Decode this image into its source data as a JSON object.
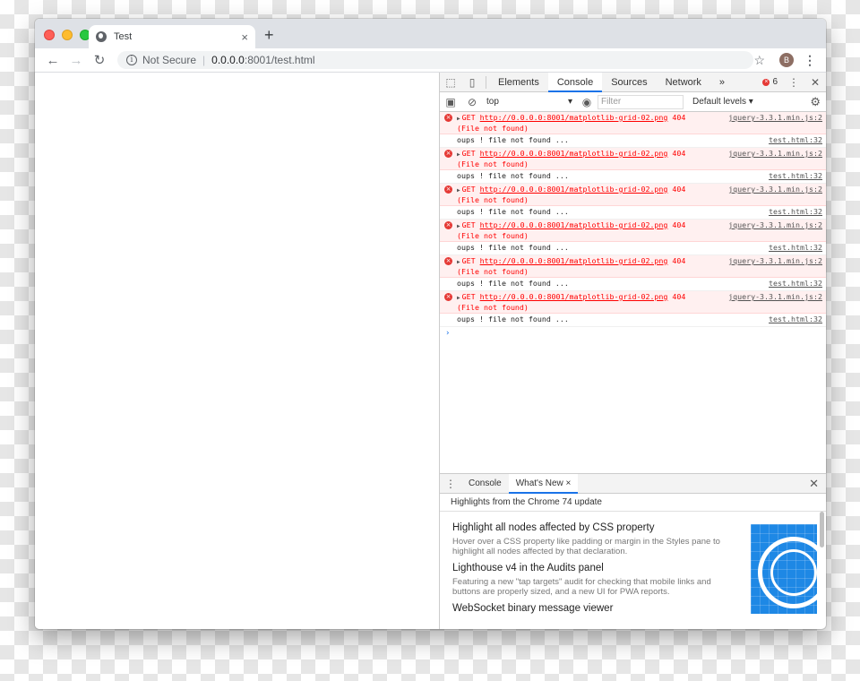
{
  "browser": {
    "tab_title": "Test",
    "tab_close": "×",
    "new_tab": "+",
    "url_security": "Not Secure",
    "url_host": "0.0.0.0",
    "url_rest": ":8001/test.html",
    "avatar_initial": "B"
  },
  "devtools": {
    "tabs": [
      "Elements",
      "Console",
      "Sources",
      "Network"
    ],
    "more_tabs": "»",
    "active_tab": "Console",
    "error_count": "6",
    "context": "top",
    "filter_placeholder": "Filter",
    "levels": "Default levels ▾",
    "messages": [
      {
        "type": "error",
        "method": "GET",
        "url": "http://0.0.0.0:8001/matplotlib-grid-02.png",
        "status": "404",
        "detail": "(File not found)",
        "source": "jquery-3.3.1.min.js:2"
      },
      {
        "type": "log",
        "text": "oups ! file not found ...",
        "source": "test.html:32"
      },
      {
        "type": "error",
        "method": "GET",
        "url": "http://0.0.0.0:8001/matplotlib-grid-02.png",
        "status": "404",
        "detail": "(File not found)",
        "source": "jquery-3.3.1.min.js:2"
      },
      {
        "type": "log",
        "text": "oups ! file not found ...",
        "source": "test.html:32"
      },
      {
        "type": "error",
        "method": "GET",
        "url": "http://0.0.0.0:8001/matplotlib-grid-02.png",
        "status": "404",
        "detail": "(File not found)",
        "source": "jquery-3.3.1.min.js:2"
      },
      {
        "type": "log",
        "text": "oups ! file not found ...",
        "source": "test.html:32"
      },
      {
        "type": "error",
        "method": "GET",
        "url": "http://0.0.0.0:8001/matplotlib-grid-02.png",
        "status": "404",
        "detail": "(File not found)",
        "source": "jquery-3.3.1.min.js:2"
      },
      {
        "type": "log",
        "text": "oups ! file not found ...",
        "source": "test.html:32"
      },
      {
        "type": "error",
        "method": "GET",
        "url": "http://0.0.0.0:8001/matplotlib-grid-02.png",
        "status": "404",
        "detail": "(File not found)",
        "source": "jquery-3.3.1.min.js:2"
      },
      {
        "type": "log",
        "text": "oups ! file not found ...",
        "source": "test.html:32"
      },
      {
        "type": "error",
        "method": "GET",
        "url": "http://0.0.0.0:8001/matplotlib-grid-02.png",
        "status": "404",
        "detail": "(File not found)",
        "source": "jquery-3.3.1.min.js:2"
      },
      {
        "type": "log",
        "text": "oups ! file not found ...",
        "source": "test.html:32"
      }
    ],
    "prompt": "›",
    "drawer": {
      "tabs": [
        "Console",
        "What's New"
      ],
      "active_tab": "What's New",
      "tab_close": "×",
      "header": "Highlights from the Chrome 74 update",
      "features": [
        {
          "title": "Highlight all nodes affected by CSS property",
          "desc": "Hover over a CSS property like padding or margin in the Styles pane to highlight all nodes affected by that declaration."
        },
        {
          "title": "Lighthouse v4 in the Audits panel",
          "desc": "Featuring a new \"tap targets\" audit for checking that mobile links and buttons are properly sized, and a new UI for PWA reports."
        },
        {
          "title": "WebSocket binary message viewer",
          "desc": ""
        }
      ]
    }
  },
  "colors": {
    "error_text": "#ff0000",
    "error_bg": "#fff0f0",
    "accent": "#1a73e8",
    "thumb": "#1e88e5"
  }
}
